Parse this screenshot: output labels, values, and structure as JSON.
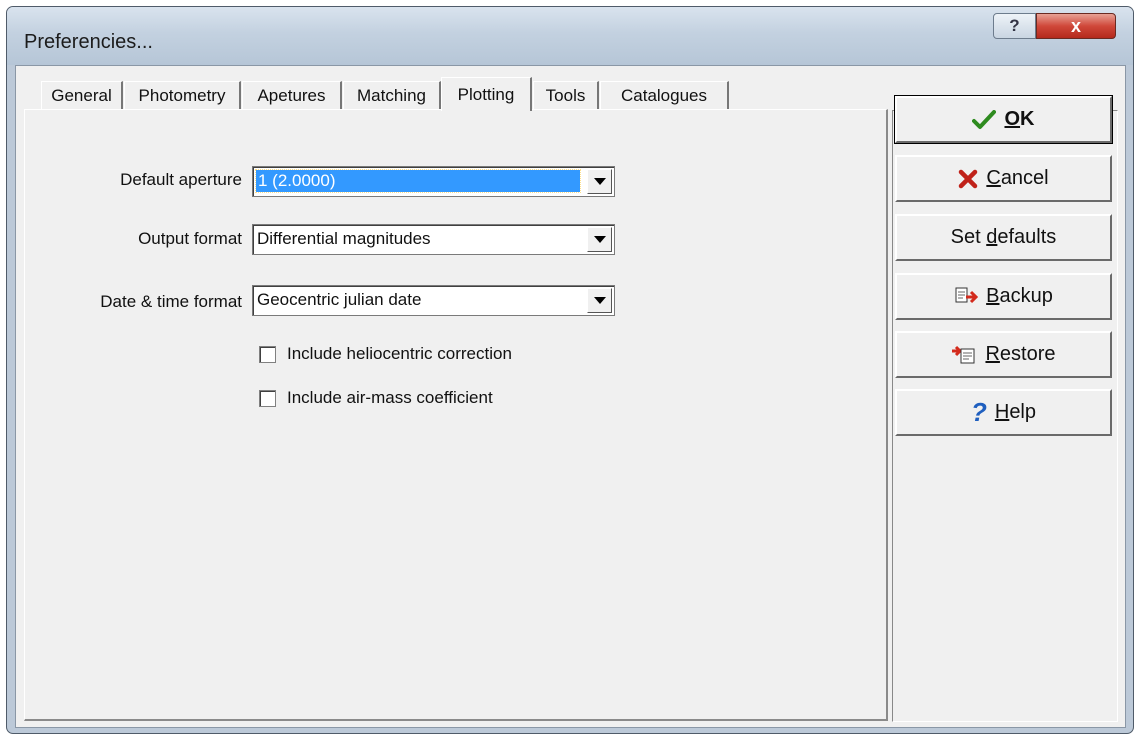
{
  "window": {
    "title": "Preferencies..."
  },
  "title_controls": {
    "help_glyph": "?",
    "close_glyph": "x"
  },
  "tabs": [
    {
      "label": "General"
    },
    {
      "label": "Photometry"
    },
    {
      "label": "Apetures"
    },
    {
      "label": "Matching"
    },
    {
      "label": "Plotting",
      "active": true
    },
    {
      "label": "Tools"
    },
    {
      "label": "Catalogues"
    }
  ],
  "form": {
    "default_aperture": {
      "label": "Default aperture",
      "value": "1 (2.0000)"
    },
    "output_format": {
      "label": "Output format",
      "value": "Differential magnitudes"
    },
    "date_time_format": {
      "label": "Date & time format",
      "value": "Geocentric julian date"
    },
    "heliocentric": {
      "label": "Include heliocentric correction",
      "checked": false
    },
    "airmass": {
      "label": "Include air-mass coefficient",
      "checked": false
    }
  },
  "buttons": {
    "ok": {
      "pre": "",
      "key": "O",
      "post": "K",
      "icon": "check-icon"
    },
    "cancel": {
      "pre": "",
      "key": "C",
      "post": "ancel",
      "icon": "x-icon"
    },
    "set_defaults": {
      "pre": "Set ",
      "key": "d",
      "post": "efaults"
    },
    "backup": {
      "pre": "",
      "key": "B",
      "post": "ackup",
      "icon": "backup-icon"
    },
    "restore": {
      "pre": "",
      "key": "R",
      "post": "estore",
      "icon": "restore-icon"
    },
    "help": {
      "pre": "",
      "key": "H",
      "post": "elp",
      "icon": "question-icon"
    }
  },
  "colors": {
    "selection": "#3399ff",
    "ok_check": "#2e8b1f",
    "cancel_x": "#c0221a",
    "help_q": "#1f5fbf"
  }
}
